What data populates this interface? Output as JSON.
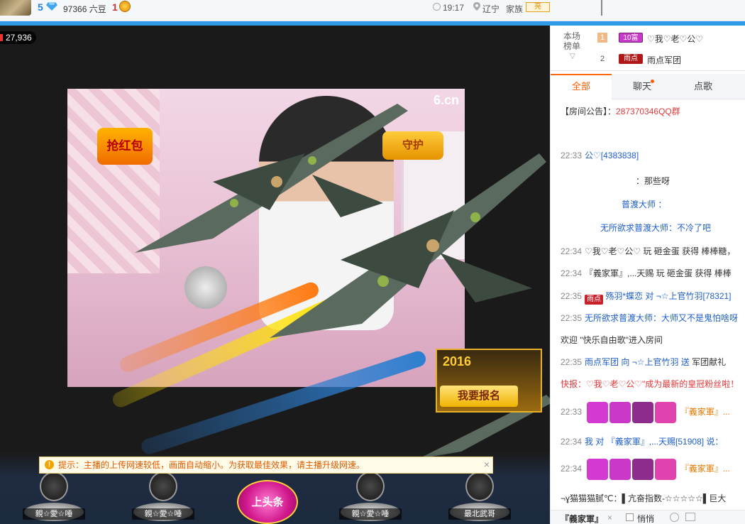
{
  "topbar": {
    "level": "5",
    "beans": "97366 六豆",
    "rank": "1",
    "time": "19:17",
    "location": "辽宁",
    "family_label": "家族",
    "family_badge": "亮"
  },
  "stage": {
    "viewer_count": "27,936",
    "watermark": "6.cn",
    "guard_badge": "守护",
    "redbag_badge": "抢红包",
    "promo_title": "2016",
    "promo_button": "我要报名",
    "notice": "提示：主播的上传网速较低，画面自动缩小。为获取最佳效果，请主播升级网速。",
    "fans": [
      {
        "tag": "親☆愛☆唾"
      },
      {
        "tag": "親☆愛☆唾"
      },
      {
        "tag": "親☆愛☆唾"
      },
      {
        "tag": "最北武哥"
      }
    ],
    "headline_label": "上头条"
  },
  "panel": {
    "rank_title": "本场\n榜单",
    "rank_list": [
      {
        "num": "1",
        "badge": "10富",
        "name": "♡我♡老♡公♡"
      },
      {
        "num": "2",
        "badge": "雨点",
        "name": "雨点军团"
      }
    ],
    "tabs": [
      {
        "label": "全部"
      },
      {
        "label": "聊天"
      },
      {
        "label": "点歌"
      }
    ],
    "chat": [
      {
        "text": "【房间公告】：",
        "extra": "287370346QQ群"
      },
      {
        "time": "22:33",
        "text": "公♡[4383838]"
      },
      {
        "text": "：那些呀"
      },
      {
        "text": "普渡大师 ："
      },
      {
        "text": "无所欲求普渡大师：不冷了吧"
      },
      {
        "time": "22:34",
        "text": "♡我♡老♡公♡ 玩 砸金蛋 获得",
        "extra": "棒棒糖，"
      },
      {
        "time": "22:34",
        "text": "『義家軍』,...天赐 玩 砸金蛋 获得",
        "extra": "棒棒"
      },
      {
        "time": "22:35",
        "text": "殇羽*蝶恋 对 ¬☆上官竹羽[78321]"
      },
      {
        "time": "22:35",
        "text": "无所欲求普渡大师：大师又不是鬼怕啥呀"
      },
      {
        "text": "欢迎 \"快乐自由歌\"进入房间"
      },
      {
        "time": "22:35",
        "text": "雨点军团 向 ¬☆上官竹羽 送",
        "extra": "军团献礼"
      },
      {
        "text": "快报：♡我♡老♡公♡\"成为最新的皇冠粉丝啦！"
      },
      {
        "time": "22:33",
        "text": "『義家軍』..."
      },
      {
        "time": "22:34",
        "text": "我 对 『義家軍』,...天赐[51908] 说："
      },
      {
        "time": "22:34",
        "text": "『義家軍』..."
      },
      {
        "text": "¬ɣ猫猫猫腻℃：▌亢奋指数-☆☆☆☆☆▌巨大"
      }
    ],
    "input": {
      "target": "『義家軍』",
      "close": "×",
      "quiet_label": "悄悄"
    }
  }
}
